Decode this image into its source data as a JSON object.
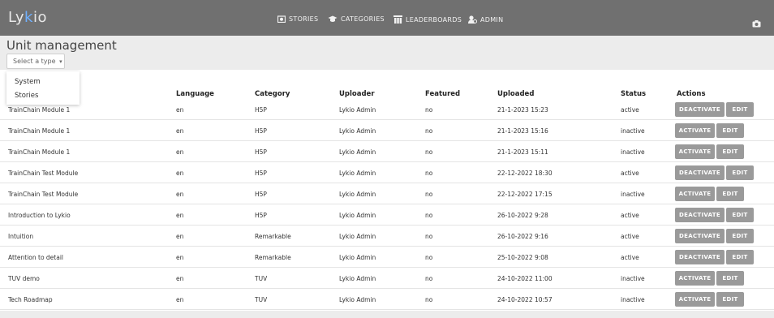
{
  "header": {
    "logo_text": "Lykio",
    "nav": [
      {
        "label": "STORIES",
        "icon": "stories-icon"
      },
      {
        "label": "CATEGORIES",
        "icon": "graduation-cap-icon"
      },
      {
        "label": "LEADERBOARDS",
        "icon": "leaderboard-icon"
      },
      {
        "label": "ADMIN",
        "icon": "admin-icon"
      }
    ],
    "camera_icon": "camera-icon"
  },
  "page": {
    "title": "Unit management",
    "type_select": {
      "placeholder": "Select a type",
      "caret": "▾"
    },
    "type_options": [
      "System",
      "Stories"
    ]
  },
  "table": {
    "columns": [
      "Language",
      "Category",
      "Uploader",
      "Featured",
      "Uploaded",
      "Status",
      "Actions"
    ],
    "rows": [
      {
        "title": "TrainChain Module 1",
        "language": "en",
        "category": "H5P",
        "uploader": "Lykio Admin",
        "featured": "no",
        "uploaded": "21-1-2023 15:23",
        "status": "active",
        "action": "DEACTIVATE",
        "edit": "EDIT"
      },
      {
        "title": "TrainChain Module 1",
        "language": "en",
        "category": "H5P",
        "uploader": "Lykio Admin",
        "featured": "no",
        "uploaded": "21-1-2023 15:16",
        "status": "inactive",
        "action": "ACTIVATE",
        "edit": "EDIT"
      },
      {
        "title": "TrainChain Module 1",
        "language": "en",
        "category": "H5P",
        "uploader": "Lykio Admin",
        "featured": "no",
        "uploaded": "21-1-2023 15:11",
        "status": "inactive",
        "action": "ACTIVATE",
        "edit": "EDIT"
      },
      {
        "title": "TrainChain Test Module",
        "language": "en",
        "category": "H5P",
        "uploader": "Lykio Admin",
        "featured": "no",
        "uploaded": "22-12-2022 18:30",
        "status": "active",
        "action": "DEACTIVATE",
        "edit": "EDIT"
      },
      {
        "title": "TrainChain Test Module",
        "language": "en",
        "category": "H5P",
        "uploader": "Lykio Admin",
        "featured": "no",
        "uploaded": "22-12-2022 17:15",
        "status": "inactive",
        "action": "ACTIVATE",
        "edit": "EDIT"
      },
      {
        "title": "Introduction to Lykio",
        "language": "en",
        "category": "H5P",
        "uploader": "Lykio Admin",
        "featured": "no",
        "uploaded": "26-10-2022 9:28",
        "status": "active",
        "action": "DEACTIVATE",
        "edit": "EDIT"
      },
      {
        "title": "Intuition",
        "language": "en",
        "category": "Remarkable",
        "uploader": "Lykio Admin",
        "featured": "no",
        "uploaded": "26-10-2022 9:16",
        "status": "active",
        "action": "DEACTIVATE",
        "edit": "EDIT"
      },
      {
        "title": "Attention to detail",
        "language": "en",
        "category": "Remarkable",
        "uploader": "Lykio Admin",
        "featured": "no",
        "uploaded": "25-10-2022 9:08",
        "status": "active",
        "action": "DEACTIVATE",
        "edit": "EDIT"
      },
      {
        "title": "TUV demo",
        "language": "en",
        "category": "TUV",
        "uploader": "Lykio Admin",
        "featured": "no",
        "uploaded": "24-10-2022 11:00",
        "status": "inactive",
        "action": "ACTIVATE",
        "edit": "EDIT"
      },
      {
        "title": "Tech Roadmap",
        "language": "en",
        "category": "TUV",
        "uploader": "Lykio Admin",
        "featured": "no",
        "uploaded": "24-10-2022 10:57",
        "status": "inactive",
        "action": "ACTIVATE",
        "edit": "EDIT"
      }
    ]
  }
}
